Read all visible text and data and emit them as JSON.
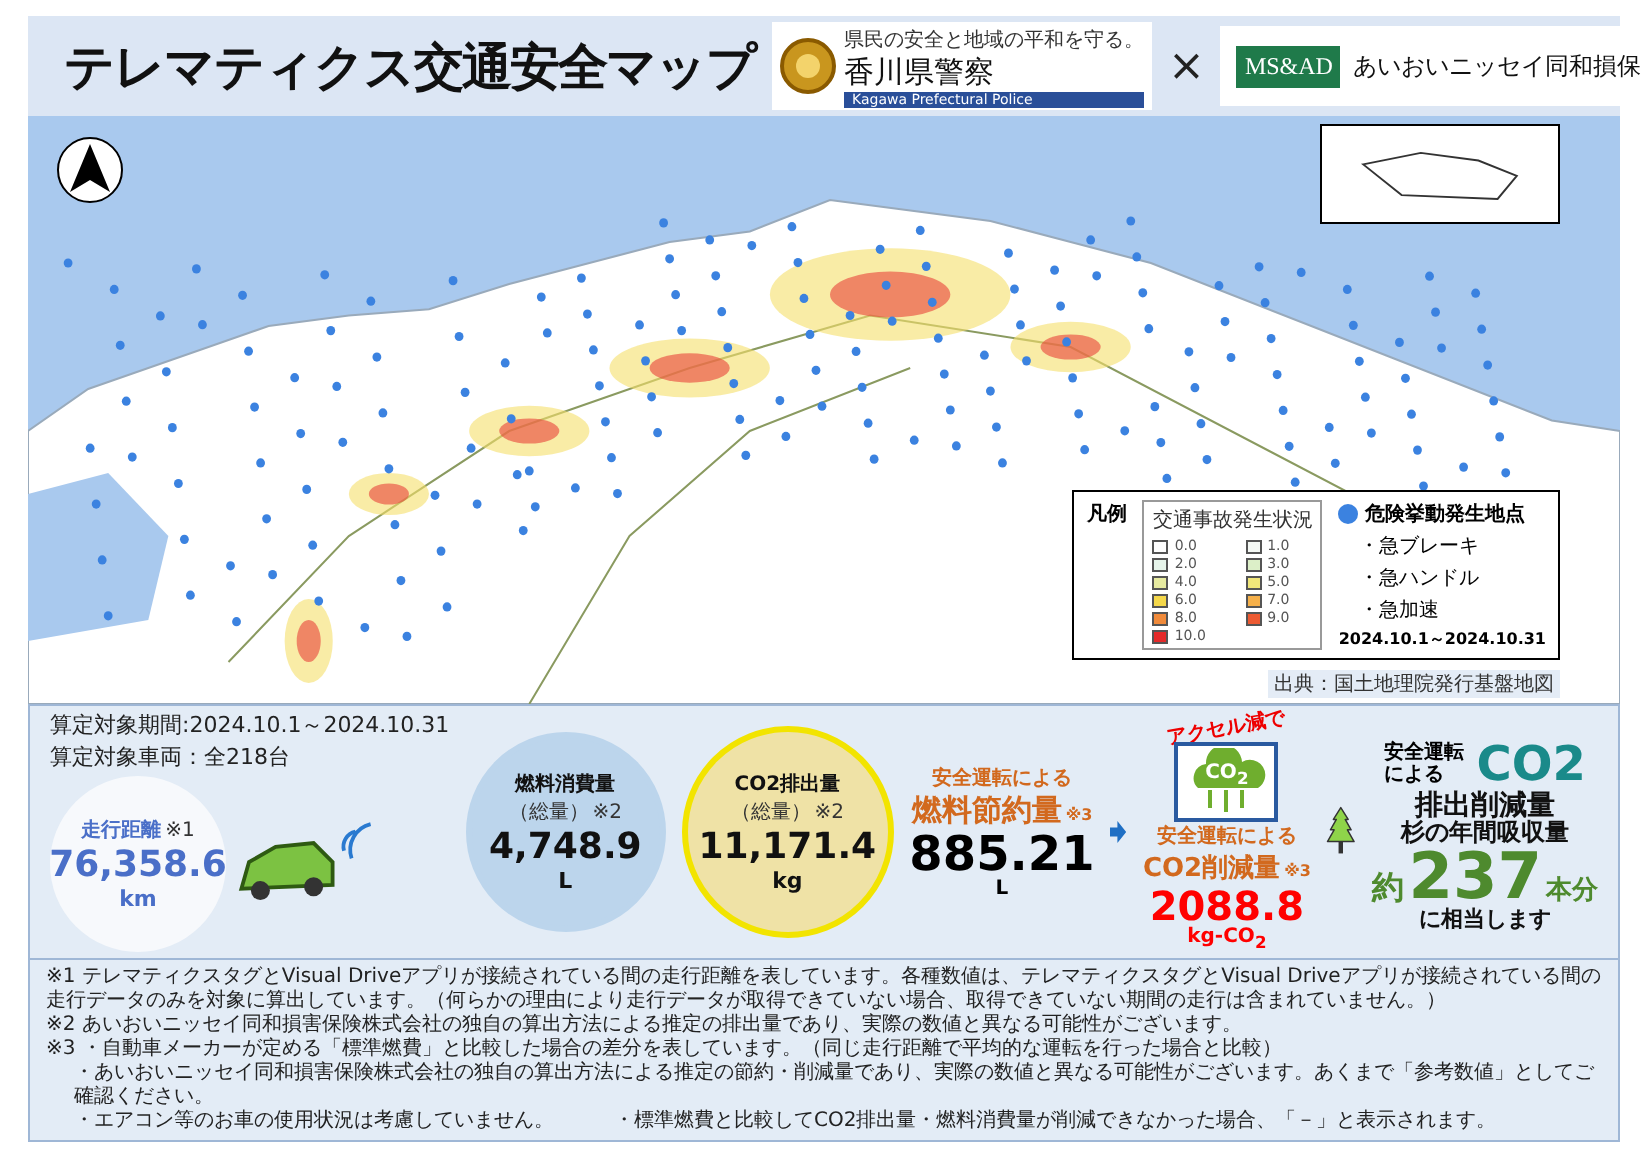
{
  "header": {
    "title": "テレマティクス交通安全マップ",
    "police_logo": {
      "tagline": "県民の安全と地域の平和を守る。",
      "name": "香川県警察",
      "english": "Kagawa Prefectural Police"
    },
    "separator": "×",
    "partner_logo": {
      "mark": "MS&AD",
      "name": "あいおいニッセイ同和損保"
    }
  },
  "map": {
    "legend": {
      "heading": "凡例",
      "scale_title": "交通事故発生状況",
      "scale": [
        {
          "label": "0.0",
          "color": "#ffffff"
        },
        {
          "label": "1.0",
          "color": "#f4f8f4"
        },
        {
          "label": "2.0",
          "color": "#e6f4ea"
        },
        {
          "label": "3.0",
          "color": "#dcefc8"
        },
        {
          "label": "4.0",
          "color": "#e6eaa0"
        },
        {
          "label": "5.0",
          "color": "#f0e67a"
        },
        {
          "label": "6.0",
          "color": "#f5d84a"
        },
        {
          "label": "7.0",
          "color": "#f5b04a"
        },
        {
          "label": "8.0",
          "color": "#f08a3a"
        },
        {
          "label": "9.0",
          "color": "#ec5a32"
        },
        {
          "label": "10.0",
          "color": "#e42a2a"
        }
      ],
      "points_title": "危険挙動発生地点",
      "points": [
        "・急ブレーキ",
        "・急ハンドル",
        "・急加速"
      ],
      "period": "2024.10.1～2024.10.31"
    },
    "attribution": "出典：国土地理院発行基盤地図"
  },
  "summary": {
    "period": "算定対象期間:2024.10.1～2024.10.31",
    "vehicles": "算定対象車両：全218台",
    "metrics": [
      {
        "kind": "distance",
        "label": "走行距離",
        "note": "※1",
        "value": "76,358.6",
        "unit": "km"
      },
      {
        "kind": "fuel",
        "label": "燃料消費量",
        "sub": "（総量）",
        "note": "※2",
        "value": "4,748.9",
        "unit": "L"
      },
      {
        "kind": "co2",
        "label": "CO2排出量",
        "sub": "（総量）",
        "note": "※2",
        "value": "11,171.4",
        "unit": "kg"
      }
    ],
    "savings": {
      "caption": "安全運転による",
      "label": "燃料節約量",
      "note": "※3",
      "value": "885.21",
      "unit": "L"
    },
    "reduction": {
      "badge": "アクセル減で",
      "icon_text": "CO$_{2}$",
      "caption": "安全運転による",
      "label": "CO2削減量",
      "note": "※3",
      "value": "2088.8",
      "unit": "kg-CO$_{2}$"
    },
    "equivalent": {
      "caption": "安全運転による",
      "co2": "CO2",
      "label": "排出削減量",
      "tree_caption": "杉の年間吸収量",
      "prefix": "約",
      "value": "237",
      "suffix": "本分",
      "closing": "に相当します"
    }
  },
  "footnotes": [
    [
      "※1 テレマティクスタグとVisual Driveアプリが接続されている間の走行距離を表しています。各種数値は、テレマティクスタグとVisual Driveアプリが接続されている間の走行データのみを対象に算出しています。（何らかの理由により走行データが取得できていない場合、取得できていない期間の走行は含まれていません。）"
    ],
    [
      "※2 あいおいニッセイ同和損害保険株式会社の独自の算出方法による推定の排出量であり、実際の数値と異なる可能性がございます。"
    ],
    [
      "※3 ・自動車メーカーが定める「標準燃費」と比較した場合の差分を表しています。（同じ走行距離で平均的な運転を行った場合と比較）"
    ],
    [
      "・あいおいニッセイ同和損害保険株式会社の独自の算出方法による推定の節約・削減量であり、実際の数値と異なる可能性がございます。あくまで「参考数値」としてご確認ください。"
    ],
    [
      "・エアコン等のお車の使用状況は考慮していません。",
      "・標準燃費と比較してCO2排出量・燃料消費量が削減できなかった場合、「－」と表示されます。"
    ]
  ]
}
